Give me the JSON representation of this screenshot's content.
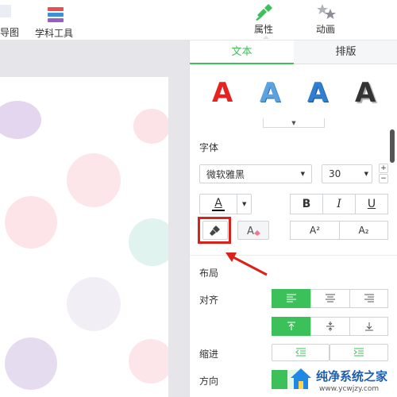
{
  "toolbar": {
    "left_cut_label": "导图",
    "subject_tools_label": "学科工具",
    "properties_label": "属性",
    "animation_label": "动画"
  },
  "panel": {
    "tabs": [
      "文本",
      "排版"
    ],
    "active_tab": "文本",
    "style_presets": [
      "A",
      "A",
      "A",
      "A"
    ],
    "font_section_label": "字体",
    "font_name": "微软雅黑",
    "font_size": "30",
    "bold_label": "B",
    "italic_label": "I",
    "underline_label": "U",
    "font_color_glyph": "A",
    "superscript_label": "A²",
    "subscript_label": "A₂",
    "layout_section_label": "布局",
    "align_label": "对齐",
    "indent_label": "缩进",
    "direction_label": "方向",
    "spin_up": "+",
    "spin_down": "−"
  },
  "colors": {
    "accent_green": "#3cc05a",
    "highlight_red": "#d9221a"
  },
  "watermark": {
    "text": "纯净系统之家",
    "url": "www.ycwjzy.com"
  }
}
